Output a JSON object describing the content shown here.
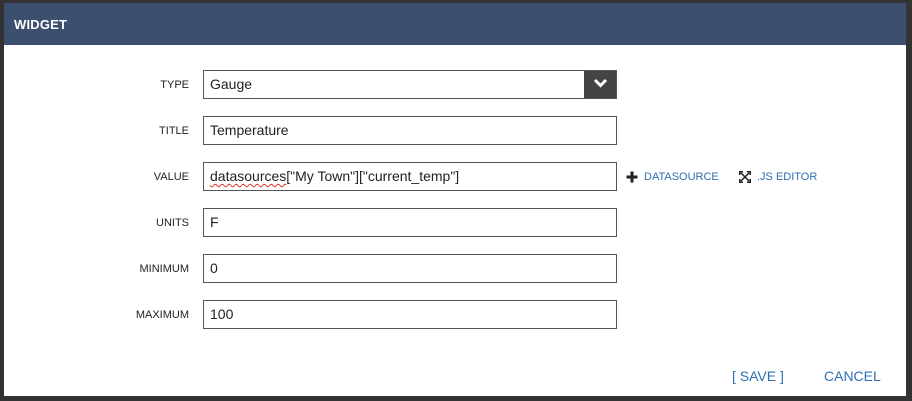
{
  "dialog": {
    "title": "WIDGET"
  },
  "form": {
    "type": {
      "label": "TYPE",
      "value": "Gauge"
    },
    "title": {
      "label": "TITLE",
      "value": "Temperature"
    },
    "value": {
      "label": "VALUE",
      "value_prefix": "datasources",
      "value_rest": "[\"My Town\"][\"current_temp\"]"
    },
    "units": {
      "label": "UNITS",
      "value": "F"
    },
    "minimum": {
      "label": "MINIMUM",
      "value": "0"
    },
    "maximum": {
      "label": "MAXIMUM",
      "value": "100"
    }
  },
  "actions": {
    "datasource_label": "DATASOURCE",
    "js_editor_label": ".JS EDITOR"
  },
  "footer": {
    "save_label": "[ SAVE ]",
    "cancel_label": "CANCEL"
  },
  "colors": {
    "header_bg": "#3d4f6e",
    "link": "#2d6fb3",
    "select_arrow_bg": "#444444"
  },
  "icons": {
    "select": "chevron-down-icon",
    "datasource": "plus-icon",
    "js_editor": "expand-icon"
  }
}
